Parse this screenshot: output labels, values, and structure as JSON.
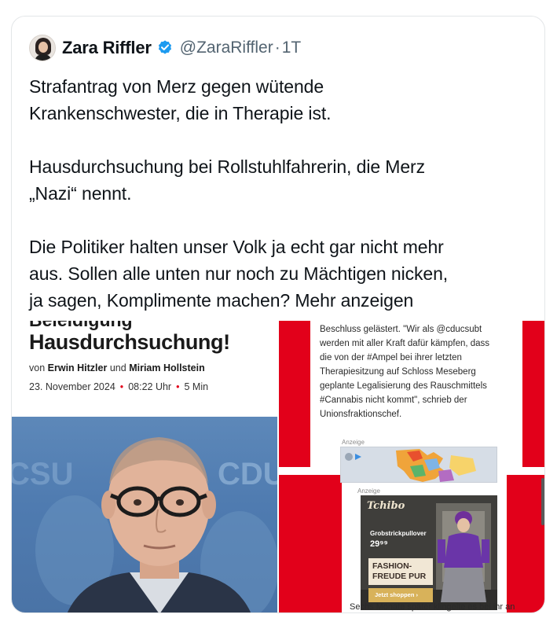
{
  "tweet": {
    "author_name": "Zara Riffler",
    "handle": "@ZaraRiffler",
    "separator": "·",
    "time": "1T",
    "verified_icon": "verified-badge-icon",
    "paragraphs": [
      [
        "Strafantrag von Merz gegen wütende",
        "Krankenschwester, die in Therapie ist."
      ],
      [
        "Hausdurchsuchung bei Rollstuhlfahrerin, die Merz",
        "„Nazi“ nennt."
      ],
      [
        "Die Politiker halten unser Volk ja echt gar nicht mehr",
        "aus. Sollen alle unten nur noch zu Mächtigen nicken,",
        "ja sagen, Komplimente machen?"
      ]
    ],
    "show_more": "Mehr anzeigen"
  },
  "media": {
    "left": {
      "headline_cut": "Beleidigung",
      "headline": "Hausdurchsuchung!",
      "byline_prefix": "von",
      "author1": "Erwin Hitzler",
      "byline_and": "und",
      "author2": "Miriam Hollstein",
      "date": "23. November 2024",
      "time": "08:22 Uhr",
      "read_time": "5 Min",
      "bullet": "•",
      "photo_bg_text_left": "CSU",
      "photo_bg_text_right": "CDU"
    },
    "right": {
      "article_lines": [
        "Beschluss gelästert. \"Wir als @cducsubt",
        "werden mit aller Kraft dafür kämpfen, dass",
        "die von der #Ampel bei ihrer letzten",
        "Therapiesitzung auf Schloss Meseberg",
        "geplante Legalisierung des Rauschmittels",
        "#Cannabis nicht kommt\", schrieb der",
        "Unionsfraktionschef."
      ],
      "ad_label_1": "Anzeige",
      "ad_label_2": "Anzeige",
      "ad_brand": "Tchibo",
      "ad_product": "Grobstrickpullover",
      "ad_price": "29⁹⁹",
      "ad_slogan": "FASHION-FREUDE PUR",
      "ad_cta": "Jetzt shoppen  ›",
      "bottom_line": "Sechs Monate später klingelte es bei ihr an"
    }
  },
  "colors": {
    "accent_red": "#e2001a",
    "verified_blue": "#1d9bf0",
    "muted": "#536471"
  }
}
